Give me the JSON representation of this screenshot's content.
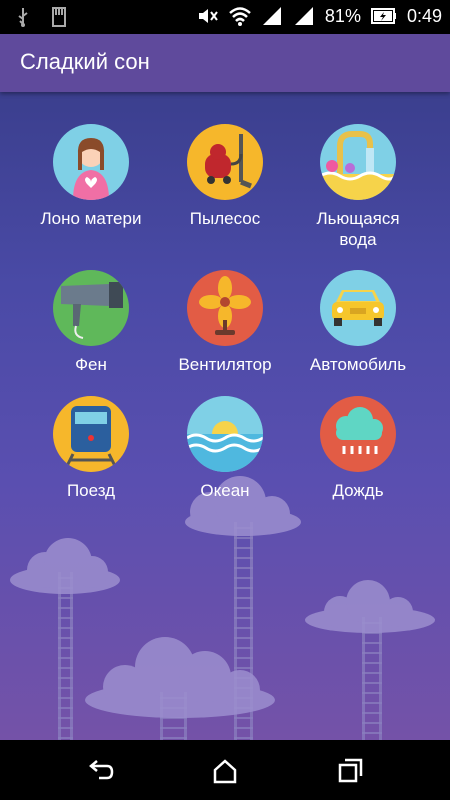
{
  "status_bar": {
    "battery": "81%",
    "time": "0:49",
    "icons": [
      "usb-icon",
      "sd-card-icon",
      "mute-icon",
      "wifi-icon",
      "signal-icon",
      "battery-charging-icon"
    ]
  },
  "app_bar": {
    "title": "Сладкий сон"
  },
  "tiles": [
    {
      "label": "Лоно матери",
      "icon": "mother-womb-icon",
      "color": "#7fd0e6"
    },
    {
      "label": "Пылесос",
      "icon": "vacuum-cleaner-icon",
      "color": "#f6b72b"
    },
    {
      "label": "Льющаяся\nвода",
      "icon": "running-water-icon",
      "color": "#7fd0e6"
    },
    {
      "label": "Фен",
      "icon": "hair-dryer-icon",
      "color": "#5fb85a"
    },
    {
      "label": "Вентилятор",
      "icon": "fan-icon",
      "color": "#e25c45"
    },
    {
      "label": "Автомобиль",
      "icon": "car-icon",
      "color": "#7fd0e6"
    },
    {
      "label": "Поезд",
      "icon": "train-icon",
      "color": "#f6b72b"
    },
    {
      "label": "Океан",
      "icon": "ocean-icon",
      "color": "#7fd0e6"
    },
    {
      "label": "Дождь",
      "icon": "rain-icon",
      "color": "#e25c45"
    }
  ],
  "nav_bar": {
    "icons": [
      "back-icon",
      "home-icon",
      "recent-apps-icon"
    ]
  }
}
